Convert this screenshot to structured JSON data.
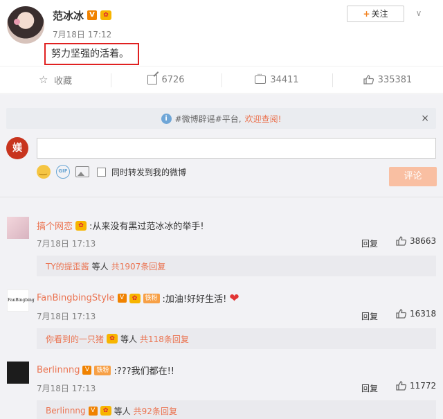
{
  "post": {
    "author": "范冰冰",
    "v_badge": "V",
    "time": "7月18日 17:12",
    "text": "努力坚强的活着。",
    "follow_plus": "+",
    "follow_label": "关注"
  },
  "actions": {
    "favorite_label": "收藏",
    "repost_count": "6726",
    "comment_count": "34411",
    "like_count": "335381"
  },
  "notice": {
    "prefix": "#微博辟谣#平台,",
    "highlight": "欢迎查阅!",
    "close": "×"
  },
  "composer": {
    "avatar_text": "媄",
    "input_value": "",
    "gif_label": "GIF",
    "forward_label": "同时转发到我的微博",
    "submit_label": "评论"
  },
  "comments": [
    {
      "user": "搞个网恋",
      "text": ":从来没有黑过范冰冰的举手!",
      "time": "7月18日 17:13",
      "reply_label": "回复",
      "likes": "38663",
      "sub_user": "TY的提歪酱",
      "sub_mid": "等人",
      "sub_count": "共1907条回复"
    },
    {
      "user": "FanBingbingStyle",
      "v_badge": "V",
      "tag": "铁粉",
      "text": ":加油!好好生活!",
      "heart": "❤",
      "time": "7月18日 17:13",
      "reply_label": "回复",
      "likes": "16318",
      "sub_user": "你看到的一只猪",
      "sub_mid": "等人",
      "sub_count": "共118条回复"
    },
    {
      "user": "Berlinnng",
      "v_badge": "V",
      "tag": "铁粉",
      "text": ":???我们都在!!",
      "time": "7月18日 17:13",
      "reply_label": "回复",
      "likes": "11772",
      "sub_user": "Berlinnng",
      "sub_v": "V",
      "sub_mid": "等人",
      "sub_count": "共92条回复"
    }
  ],
  "colors": {
    "accent": "#eb7350",
    "vip_orange": "#f08200",
    "highlight_box": "#e02020"
  }
}
